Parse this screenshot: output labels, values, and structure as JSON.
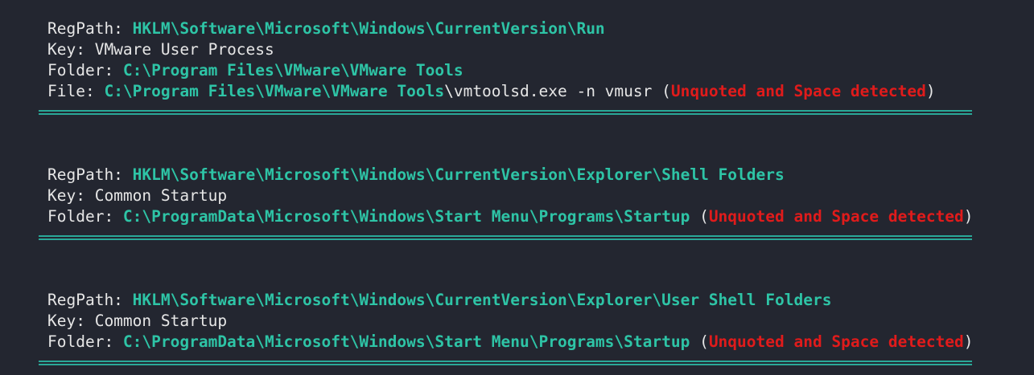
{
  "entries": [
    {
      "regpath_label": "RegPath: ",
      "regpath": "HKLM\\Software\\Microsoft\\Windows\\CurrentVersion\\Run",
      "key_label": "Key: ",
      "key": "VMware User Process",
      "folder_label": "Folder: ",
      "folder": "C:\\Program Files\\VMware\\VMware Tools",
      "file_label": "File: ",
      "file_dir": "C:\\Program Files\\VMware\\VMware Tools",
      "file_rest": "\\vmtoolsd.exe -n vmusr (",
      "warning": "Unquoted and Space detected",
      "close": ")"
    },
    {
      "regpath_label": "RegPath: ",
      "regpath": "HKLM\\Software\\Microsoft\\Windows\\CurrentVersion\\Explorer\\Shell Folders",
      "key_label": "Key: ",
      "key": "Common Startup",
      "folder_label": "Folder: ",
      "folder": "C:\\ProgramData\\Microsoft\\Windows\\Start Menu\\Programs\\Startup",
      "open": " (",
      "warning": "Unquoted and Space detected",
      "close": ")"
    },
    {
      "regpath_label": "RegPath: ",
      "regpath": "HKLM\\Software\\Microsoft\\Windows\\CurrentVersion\\Explorer\\User Shell Folders",
      "key_label": "Key: ",
      "key": "Common Startup",
      "folder_label": "Folder: ",
      "folder": "C:\\ProgramData\\Microsoft\\Windows\\Start Menu\\Programs\\Startup",
      "open": " (",
      "warning": "Unquoted and Space detected",
      "close": ")"
    }
  ],
  "colors": {
    "background": "#232630",
    "text": "#e6e6e6",
    "path": "#2ec4a6",
    "warning": "#e01b1b",
    "separator": "#2aa898"
  }
}
